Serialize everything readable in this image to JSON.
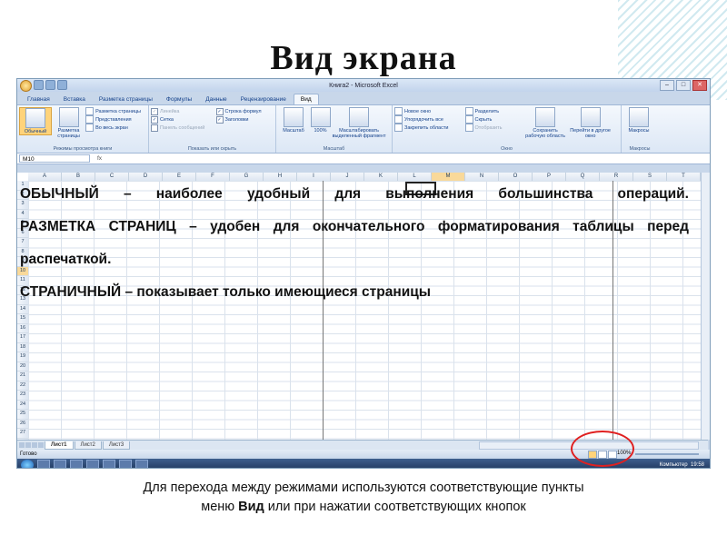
{
  "slide": {
    "title": "Вид экрана",
    "caption_line1": "Для перехода между режимами используются соответствующие пункты",
    "caption_line2_pre": "меню ",
    "caption_line2_bold": "Вид",
    "caption_line2_post": " или при нажатии  соответствующих кнопок"
  },
  "excel": {
    "window_title": "Книга2 - Microsoft Excel",
    "tabs": [
      "Главная",
      "Вставка",
      "Разметка страницы",
      "Формулы",
      "Данные",
      "Рецензирование",
      "Вид"
    ],
    "active_tab": "Вид",
    "ribbon": {
      "group1": {
        "name": "Режимы просмотра книги",
        "normal": "Обычный",
        "page_layout": "Разметка страницы",
        "small": [
          "Разметка страницы",
          "Представления",
          "Во весь экран"
        ]
      },
      "group2": {
        "name": "Показать или скрыть",
        "items": [
          "Линейка",
          "Сетка",
          "Панель сообщений",
          "Строка формул",
          "Заголовки"
        ]
      },
      "group3": {
        "name": "Масштаб",
        "zoom": "Масштаб",
        "hundred": "100%",
        "zoom_selection": "Масштабировать выделенный фрагмент"
      },
      "group4": {
        "name": "Окно",
        "items": [
          "Новое окно",
          "Упорядочить все",
          "Закрепить области",
          "Разделить",
          "Скрыть",
          "Отобразить"
        ],
        "save_ws": "Сохранить рабочую область",
        "switch": "Перейти в другое окно"
      },
      "group5": {
        "name": "Макросы",
        "macros": "Макросы"
      }
    },
    "name_box": "M10",
    "columns": [
      "A",
      "B",
      "C",
      "D",
      "E",
      "F",
      "G",
      "H",
      "I",
      "J",
      "K",
      "L",
      "M",
      "N",
      "O",
      "P",
      "Q",
      "R",
      "S",
      "T",
      "U"
    ],
    "rows": [
      "1",
      "2",
      "3",
      "4",
      "5",
      "6",
      "7",
      "8",
      "9",
      "10",
      "11",
      "12",
      "13",
      "14",
      "15",
      "16",
      "17",
      "18",
      "19",
      "20",
      "21",
      "22",
      "23",
      "24",
      "25",
      "26",
      "27",
      "28"
    ],
    "sheet_tabs": [
      "Лист1",
      "Лист2",
      "Лист3"
    ],
    "status": "Готово",
    "zoom_level": "100%",
    "tray_text": "Компьютер",
    "clock": "19:58"
  },
  "body": {
    "p1": "ОБЫЧНЫЙ – наиболее удобный для выполнения большинства операций.",
    "p2": "РАЗМЕТКА СТРАНИЦ – удобен для окончательного форматирования таблицы перед распечаткой.",
    "p3": "СТРАНИЧНЫЙ – показывает только имеющиеся страницы"
  }
}
